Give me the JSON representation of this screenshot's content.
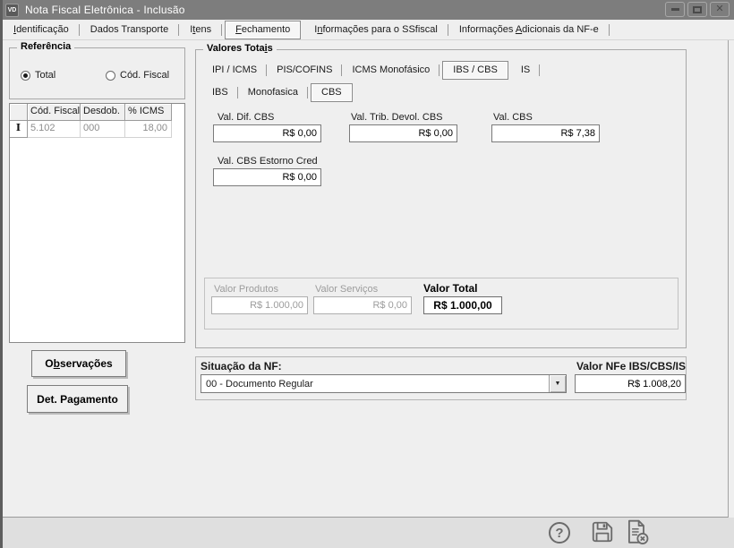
{
  "window": {
    "title": "Nota Fiscal Eletrônica - Inclusão",
    "icon_text": "VD",
    "controls": [
      {
        "name": "minimize-button"
      },
      {
        "name": "maximize-button"
      },
      {
        "name": "close-button",
        "glyph": "✕"
      }
    ]
  },
  "tabs": [
    {
      "text": "Identificação",
      "hotkey_index": 0,
      "selected": false
    },
    {
      "text": "Dados Transporte",
      "hotkey_index": -1,
      "selected": false
    },
    {
      "text": "Itens",
      "hotkey_index": 1,
      "selected": false
    },
    {
      "text": "Fechamento",
      "hotkey_index": 0,
      "selected": true
    },
    {
      "text": "Informações para o SSfiscal",
      "hotkey_index": 1,
      "selected": false
    },
    {
      "text": "Informações Adicionais da NF-e",
      "hotkey_index": 12,
      "selected": false
    }
  ],
  "referencia": {
    "title": "Referência",
    "options": [
      {
        "label": "Total",
        "selected": true
      },
      {
        "label": "Cód. Fiscal",
        "selected": false
      }
    ]
  },
  "grid": {
    "columns": [
      "",
      "Cód. Fiscal",
      "Desdob.",
      "% ICMS"
    ],
    "rows": [
      {
        "cursor_glyph": "I",
        "cod_fiscal": "5.102",
        "desdob": "000",
        "icms_pct": "18,00"
      }
    ]
  },
  "left_buttons": {
    "observacoes": {
      "text": "Observações",
      "hotkey_index": 1
    },
    "det_pagamento": {
      "text": "Det. Pagamento",
      "hotkey_index": -1
    }
  },
  "valores_totais": {
    "title": {
      "text": "Valores Totais",
      "hotkey_index": 12
    },
    "tax_tabs": [
      {
        "text": "IPI / ICMS",
        "selected": false
      },
      {
        "text": "PIS/COFINS",
        "selected": false
      },
      {
        "text": "ICMS Monofásico",
        "selected": false
      },
      {
        "text": "IBS / CBS",
        "selected": true
      },
      {
        "text": "IS",
        "selected": false
      }
    ],
    "ibs_cbs_tabs": [
      {
        "text": "IBS",
        "selected": false
      },
      {
        "text": "Monofasica",
        "selected": false
      },
      {
        "text": "CBS",
        "selected": true
      }
    ],
    "cbs_fields": [
      {
        "label": "Val. Dif. CBS",
        "value": "R$ 0,00"
      },
      {
        "label": "Val. Trib. Devol. CBS",
        "value": "R$ 0,00"
      },
      {
        "label": "Val. CBS",
        "value": "R$ 7,38"
      },
      {
        "label": "Val. CBS Estorno Cred",
        "value": "R$ 0,00"
      }
    ],
    "totals": {
      "produtos": {
        "label": "Valor Produtos",
        "value": "R$ 1.000,00",
        "disabled": true
      },
      "servicos": {
        "label": "Valor Serviços",
        "value": "R$ 0,00",
        "disabled": true
      },
      "total": {
        "label": "Valor Total",
        "value": "R$ 1.000,00",
        "disabled": false
      }
    }
  },
  "situacao": {
    "label": "Situação da NF:",
    "selected_option": "00 - Documento Regular",
    "nfe_label": "Valor NFe IBS/CBS/IS",
    "nfe_value": "R$ 1.008,20"
  },
  "footer": {
    "icons": [
      {
        "name": "help-icon",
        "glyph": "?"
      },
      {
        "name": "save-icon"
      },
      {
        "name": "cancel-nf-icon"
      }
    ]
  },
  "colors": {
    "titlebar": "#7d7d7d",
    "content_bg": "#efefef",
    "footer_bg": "#dfdfdf",
    "frame_edge": "#5e5e5e",
    "field_border": "#7a7a7a",
    "disabled_text": "#9c9c9c",
    "selected_tab_bg": "#f6f6f6",
    "icon_gray": "#6b6b6b"
  }
}
